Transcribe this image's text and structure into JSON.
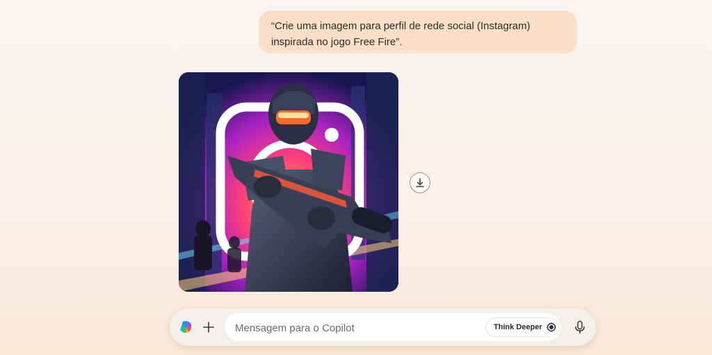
{
  "conversation": {
    "user_message": "“Crie uma imagem para perfil de rede social (Instagram) inspirada no jogo Free Fire”."
  },
  "response": {
    "image": {
      "subject": "armored soldier with rifle and Instagram logo, neon city background",
      "download_icon": "download-icon"
    }
  },
  "composer": {
    "logo_icon": "copilot-logo-icon",
    "plus_icon": "plus-icon",
    "placeholder": "Mensagem para o Copilot",
    "think_deeper_label": "Think Deeper",
    "think_icon": "think-deeper-icon",
    "mic_icon": "microphone-icon"
  },
  "colors": {
    "user_bubble": "#fbdfc8",
    "composer_bg": "#f3efeb",
    "page_bg_top": "#f8f4f1",
    "page_bg_bottom": "#fbe7d6"
  }
}
